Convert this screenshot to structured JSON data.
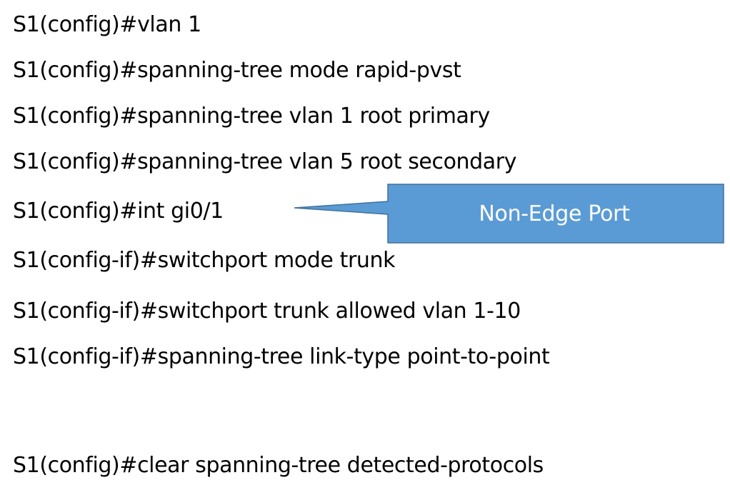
{
  "commands": [
    "S1(config)#vlan 1",
    "S1(config)#spanning-tree mode rapid-pvst",
    "S1(config)#spanning-tree vlan 1 root primary",
    "S1(config)#spanning-tree vlan 5 root secondary",
    "S1(config)#int gi0/1",
    "S1(config-if)#switchport mode trunk",
    "S1(config-if)#switchport trunk allowed vlan 1-10",
    "S1(config-if)#spanning-tree link-type point-to-point",
    "S1(config)#clear spanning-tree detected-protocols"
  ],
  "callout": {
    "label": "Non-Edge Port",
    "fill_color": "#5b9bd5",
    "border_color": "#41719c",
    "text_color": "#ffffff"
  }
}
